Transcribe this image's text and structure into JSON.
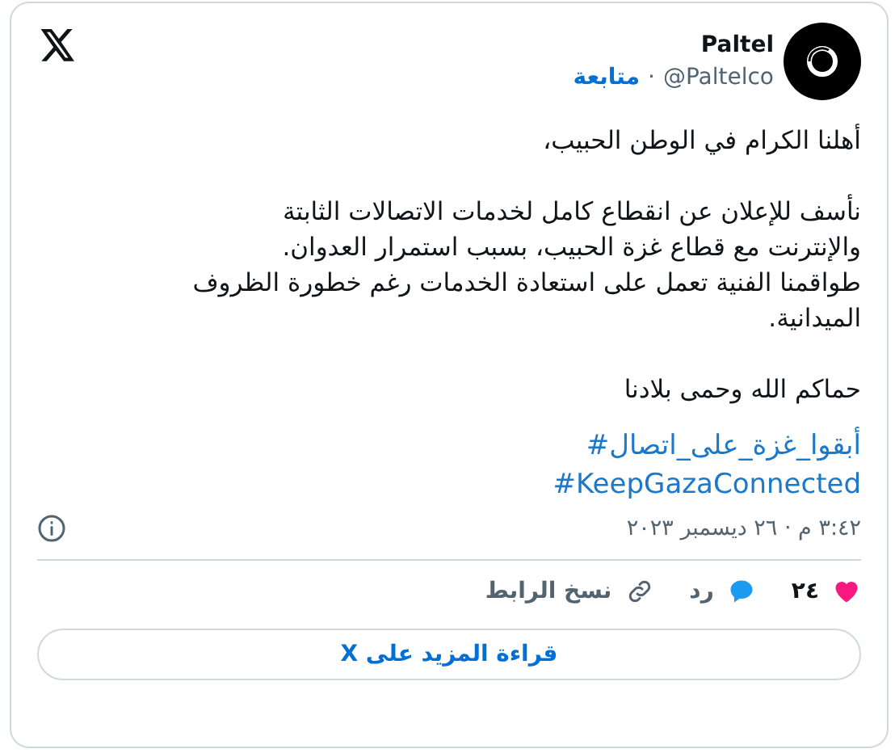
{
  "author": {
    "name": "Paltel",
    "handle": "@Paltelco",
    "separator": "·",
    "follow": "متابعة"
  },
  "body": [
    [
      "أهلنا الكرام في الوطن الحبيب،"
    ],
    [
      "نأسف للإعلان عن انقطاع كامل لخدمات الاتصالات الثابتة",
      "والإنترنت مع قطاع غزة الحبيب، بسبب استمرار العدوان.",
      "طواقمنا الفنية تعمل على استعادة الخدمات رغم خطورة الظروف",
      "الميدانية."
    ],
    [
      "حماكم الله وحمى بلادنا"
    ]
  ],
  "hashtags": [
    "#أبقوا_غزة_على_اتصال",
    "#KeepGazaConnected"
  ],
  "timestamp": "٣:٤٢ م · ٢٦ ديسمبر ٢٠٢٣",
  "actions": [
    {
      "kind": "like",
      "label": "٢٤"
    },
    {
      "kind": "reply",
      "label": "رد"
    },
    {
      "kind": "copy",
      "label": "نسخ الرابط"
    }
  ],
  "read_more": "قراءة المزيد على X"
}
